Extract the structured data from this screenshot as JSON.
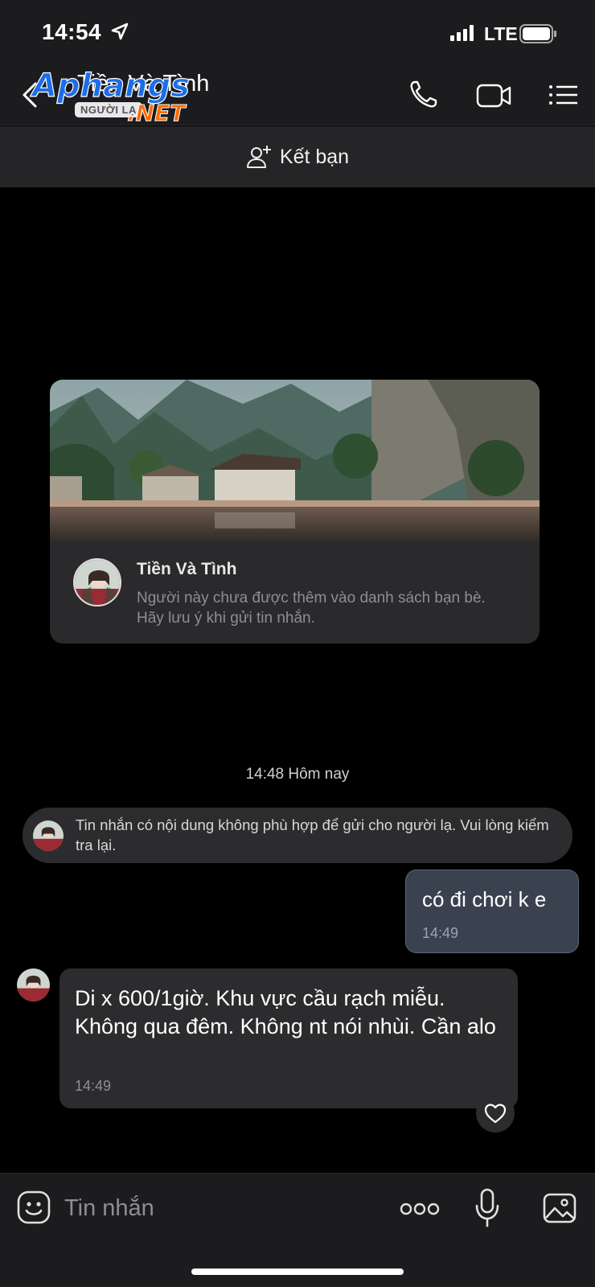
{
  "status_bar": {
    "time": "14:54",
    "network": "LTE"
  },
  "header": {
    "contact_name": "Tiền Và Tình",
    "badge": "NGƯỜI LẠ",
    "watermark_text": "Aphangs",
    "watermark_sub": ".NET"
  },
  "add_friend": {
    "label": "Kết bạn"
  },
  "profile_card": {
    "name": "Tiền Và Tình",
    "description": "Người này chưa được thêm vào danh sách bạn bè. Hãy lưu ý khi gửi tin nhắn."
  },
  "chat": {
    "time_separator": "14:48 Hôm nay",
    "system_message": "Tin nhắn có nội dung không phù hợp để gửi cho người lạ. Vui lòng kiểm tra lại.",
    "outgoing": {
      "text": "có đi chơi k e",
      "time": "14:49"
    },
    "incoming": {
      "text": "Di x 600/1giờ. Khu vực cầu rạch miễu. Không qua đêm. Không nt nói nhùi. Cần alo",
      "time": "14:49"
    }
  },
  "input_bar": {
    "placeholder": "Tin nhắn"
  },
  "colors": {
    "background": "#000000",
    "bar": "#1c1c1e",
    "outgoing_bubble": "#3a4250",
    "incoming_bubble": "#2c2c2e"
  }
}
